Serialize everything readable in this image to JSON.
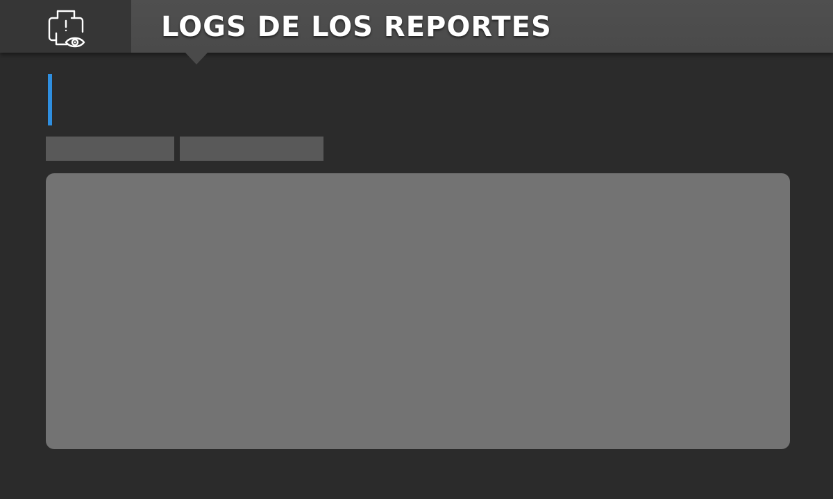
{
  "header": {
    "title": "LOGS DE LOS REPORTES",
    "icon": "printer-alert-eye-icon"
  },
  "colors": {
    "background": "#2b2b2b",
    "header": "#4d4d4d",
    "icon_box": "#363636",
    "accent": "#2f8fe0",
    "field": "#595959",
    "panel": "#737373"
  },
  "filters": {
    "first": {
      "value": "",
      "placeholder": ""
    },
    "second": {
      "value": "",
      "placeholder": ""
    }
  }
}
